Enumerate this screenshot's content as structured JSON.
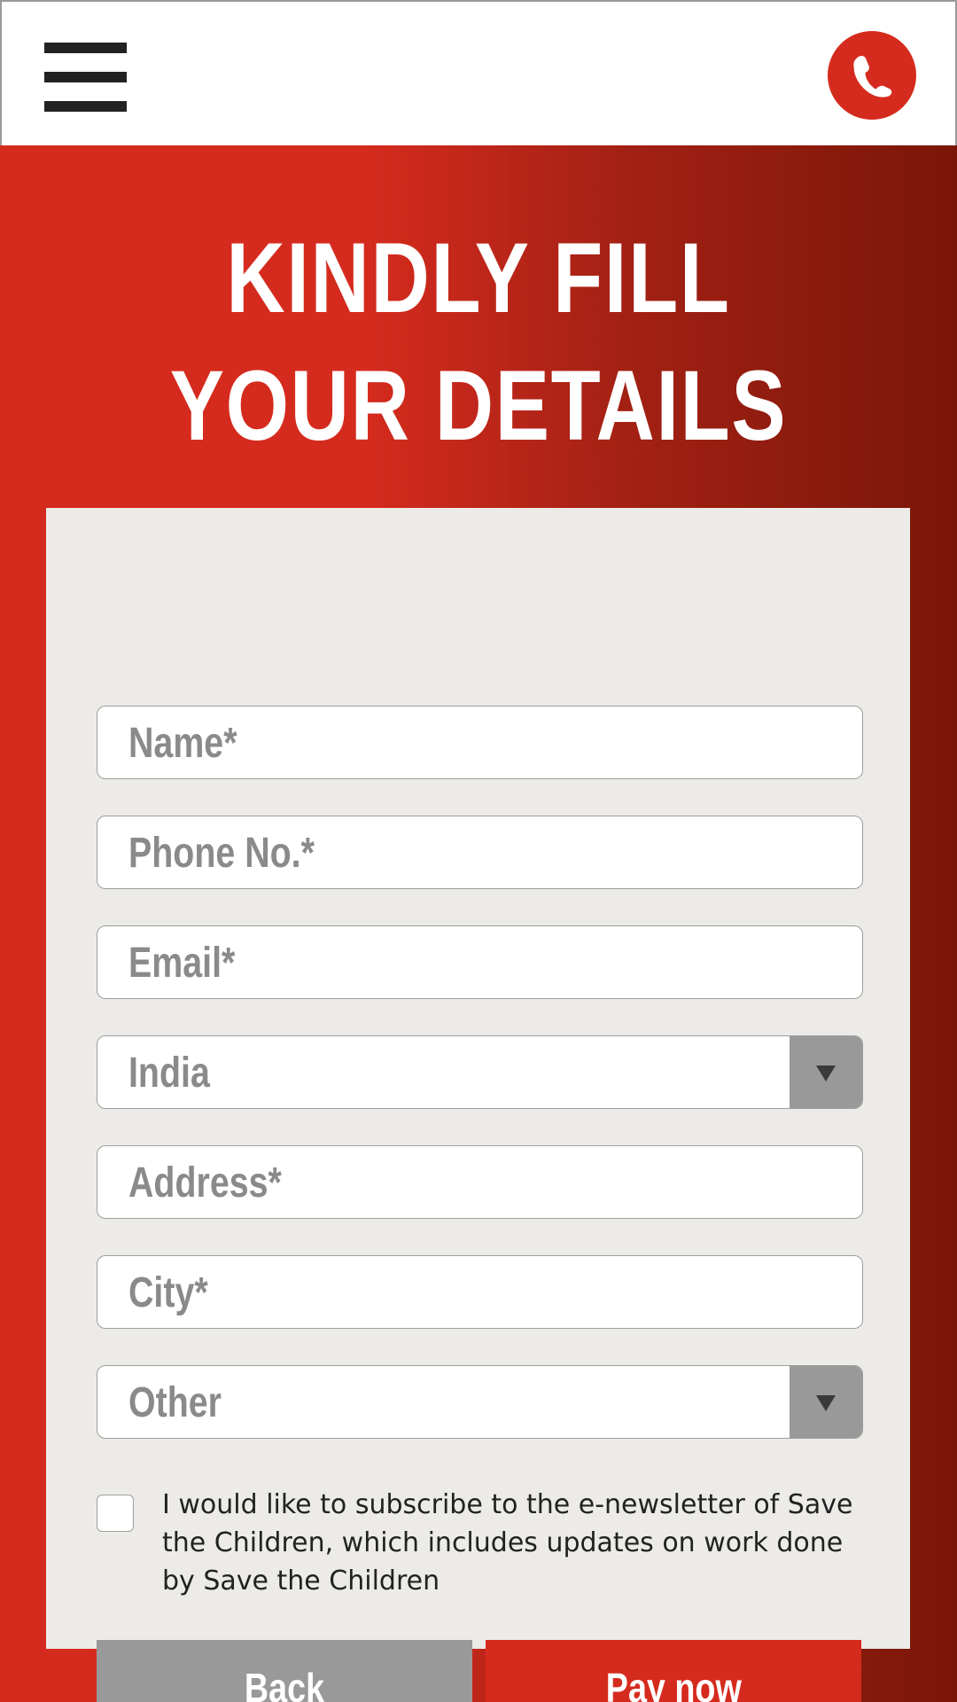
{
  "header": {
    "menu_icon": "hamburger-menu-icon",
    "call_icon": "phone-icon",
    "call_button_color": "#d52b1e"
  },
  "hero": {
    "title_line1": "KINDLY FILL",
    "title_line2": "YOUR DETAILS",
    "gradient_colors": [
      "#d52b1e",
      "#7a1608"
    ]
  },
  "form": {
    "name_placeholder": "Name*",
    "phone_placeholder": "Phone No.*",
    "email_placeholder": "Email*",
    "country_selected": "India",
    "address_placeholder": "Address*",
    "city_placeholder": "City*",
    "state_selected": "Other",
    "dropdown_icon": "triangle-down-icon",
    "newsletter_checked": false,
    "newsletter_text": "I would like to subscribe to the e-newsletter of Save the Children, which includes updates on work done by Save the Children",
    "back_label": "Back",
    "pay_label": "Pay now"
  }
}
